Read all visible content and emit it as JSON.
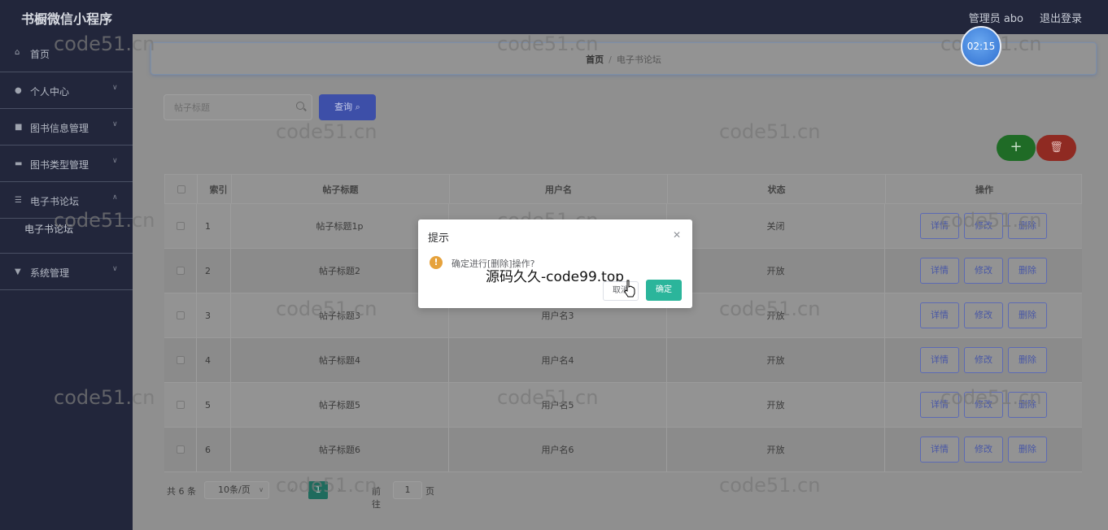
{
  "header": {
    "app_title": "书橱微信小程序",
    "admin_label": "管理员 abo",
    "logout_label": "退出登录"
  },
  "sidebar": {
    "items": [
      {
        "label": "首页",
        "icon": "home-icon"
      },
      {
        "label": "个人中心",
        "icon": "user-icon"
      },
      {
        "label": "图书信息管理",
        "icon": "book-icon"
      },
      {
        "label": "图书类型管理",
        "icon": "chat-icon"
      },
      {
        "label": "电子书论坛",
        "icon": "list-icon"
      },
      {
        "label": "系统管理",
        "icon": "settings-icon"
      }
    ],
    "sub_items": [
      {
        "label": "电子书论坛"
      }
    ]
  },
  "breadcrumb": {
    "home": "首页",
    "separator": "/",
    "current": "电子书论坛"
  },
  "search": {
    "placeholder": "帖子标题",
    "button_label": "查询"
  },
  "toolbar": {
    "add_icon": "plus-icon",
    "delete_icon": "trash-icon"
  },
  "table": {
    "headers": [
      "索引",
      "帖子标题",
      "用户名",
      "状态",
      "操作"
    ],
    "rows": [
      {
        "index": "1",
        "title": "帖子标题1p",
        "user": "",
        "status": "关闭"
      },
      {
        "index": "2",
        "title": "帖子标题2",
        "user": "",
        "status": "开放"
      },
      {
        "index": "3",
        "title": "帖子标题3",
        "user": "用户名3",
        "status": "开放"
      },
      {
        "index": "4",
        "title": "帖子标题4",
        "user": "用户名4",
        "status": "开放"
      },
      {
        "index": "5",
        "title": "帖子标题5",
        "user": "用户名5",
        "status": "开放"
      },
      {
        "index": "6",
        "title": "帖子标题6",
        "user": "用户名6",
        "status": "开放"
      }
    ],
    "row_actions": {
      "detail": "详情",
      "edit": "修改",
      "delete": "删除"
    }
  },
  "pagination": {
    "total": "共 6 条",
    "page_size": "10条/页",
    "current_page": "1",
    "goto_label": "前往",
    "goto_value": "1",
    "unit": "页"
  },
  "timer": {
    "value": "02:15"
  },
  "dialog": {
    "title": "提示",
    "message": "确定进行[删除]操作?",
    "cancel_label": "取消",
    "confirm_label": "确定"
  },
  "overlay_text": "源码久久-code99.top",
  "watermark": "code51.cn",
  "colors": {
    "sidebar_bg": "#22263b",
    "primary": "#3d4fa8",
    "success": "#2bb59b",
    "danger": "#8f2a22",
    "warning": "#e6a23c"
  }
}
